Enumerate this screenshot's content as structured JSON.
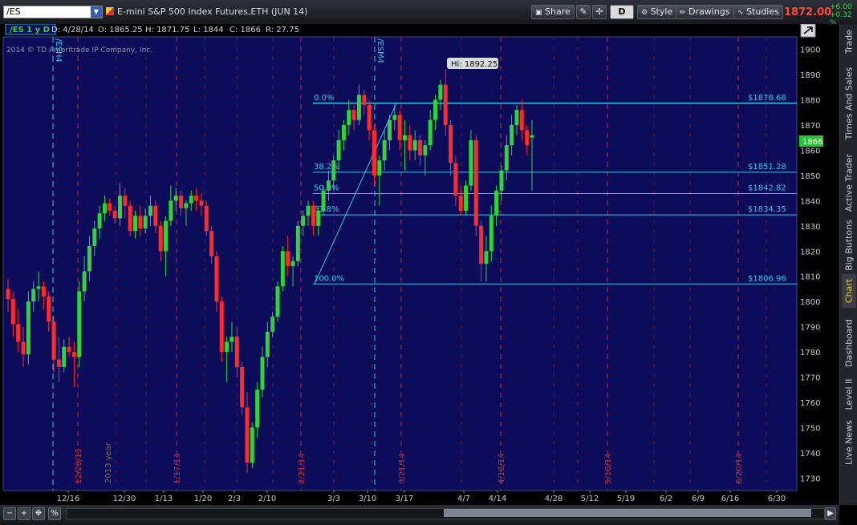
{
  "topbar": {
    "symbol": "/ES",
    "description": "E-mini S&P 500 Index Futures,ETH (JUN 14)",
    "buttons": {
      "share": "Share",
      "d": "D",
      "style": "Style",
      "drawings": "Drawings",
      "studies": "Studies"
    },
    "last_price": "1872.00",
    "change": "+6.00",
    "change_pct": "+0.32 %"
  },
  "chart_header": {
    "period": "/ES 1 y D",
    "date": "D: 4/28/14",
    "open": "O: 1865.25",
    "high": "H: 1871.75",
    "low": "L: 1844",
    "close": "C: 1866",
    "range": "R: 27.75",
    "copyright": "2014 © TD Ameritrade IP Company, Inc."
  },
  "side_tabs": [
    "Trade",
    "Times And Sales",
    "Active Trader",
    "Big Buttons",
    "Chart",
    "Dashboard",
    "Level II",
    "Live News"
  ],
  "side_active": "Chart",
  "chart_data": {
    "type": "candlestick",
    "ylim": [
      1725,
      1905
    ],
    "y_ticks": [
      1730,
      1740,
      1750,
      1760,
      1770,
      1780,
      1790,
      1800,
      1810,
      1820,
      1830,
      1840,
      1850,
      1860,
      1870,
      1880,
      1890,
      1900
    ],
    "x_ticks": [
      {
        "label": "12/16",
        "px": 85
      },
      {
        "label": "12/30",
        "px": 155
      },
      {
        "label": "1/13",
        "px": 204
      },
      {
        "label": "1/20",
        "px": 253
      },
      {
        "label": "2/3",
        "px": 292
      },
      {
        "label": "2/10",
        "px": 333
      },
      {
        "label": "3/3",
        "px": 416
      },
      {
        "label": "3/10",
        "px": 458
      },
      {
        "label": "3/17",
        "px": 504
      },
      {
        "label": "4/7",
        "px": 578
      },
      {
        "label": "4/14",
        "px": 620
      },
      {
        "label": "4/28",
        "px": 690
      },
      {
        "label": "5/12",
        "px": 735
      },
      {
        "label": "5/19",
        "px": 780
      },
      {
        "label": "6/2",
        "px": 830
      },
      {
        "label": "6/9",
        "px": 870
      },
      {
        "label": "6/16",
        "px": 910
      },
      {
        "label": "6/30",
        "px": 968
      }
    ],
    "period_lines": [
      "12/20/13",
      "1/17/14",
      "2/21/14",
      "3/21/14",
      "4/18/14",
      "5/16/14",
      "6/20/14"
    ],
    "year_label": "2013 year",
    "contract_lines": [
      "/ESH4",
      "/ESM4"
    ],
    "current_price_label": "1866",
    "high_label": "Hi: 1892.25",
    "fibonacci": [
      {
        "level": "0.0%",
        "price": "$1878.68",
        "value": 1878.68
      },
      {
        "level": "38.2%",
        "price": "$1851.28",
        "value": 1851.28
      },
      {
        "level": "50.0%",
        "price": "$1842.82",
        "value": 1842.82
      },
      {
        "level": "61.8%",
        "price": "$1834.35",
        "value": 1834.35
      },
      {
        "level": "100.0%",
        "price": "$1806.96",
        "value": 1806.96
      }
    ],
    "candles": [
      [
        1805,
        1809,
        1796,
        1801
      ],
      [
        1801,
        1804,
        1786,
        1791
      ],
      [
        1791,
        1797,
        1780,
        1784
      ],
      [
        1784,
        1790,
        1774,
        1779
      ],
      [
        1779,
        1804,
        1775,
        1800
      ],
      [
        1800,
        1808,
        1796,
        1805
      ],
      [
        1805,
        1812,
        1800,
        1806
      ],
      [
        1806,
        1808,
        1797,
        1802
      ],
      [
        1802,
        1804,
        1788,
        1792
      ],
      [
        1792,
        1794,
        1772,
        1777
      ],
      [
        1777,
        1786,
        1768,
        1774
      ],
      [
        1774,
        1785,
        1772,
        1782
      ],
      [
        1782,
        1786,
        1778,
        1780
      ],
      [
        1780,
        1784,
        1766,
        1778
      ],
      [
        1778,
        1808,
        1774,
        1804
      ],
      [
        1804,
        1818,
        1800,
        1812
      ],
      [
        1812,
        1826,
        1808,
        1822
      ],
      [
        1822,
        1832,
        1818,
        1829
      ],
      [
        1829,
        1838,
        1825,
        1835
      ],
      [
        1835,
        1842,
        1832,
        1839
      ],
      [
        1839,
        1841,
        1834,
        1836
      ],
      [
        1836,
        1838,
        1831,
        1833
      ],
      [
        1833,
        1847,
        1830,
        1842
      ],
      [
        1842,
        1845,
        1833,
        1838
      ],
      [
        1838,
        1840,
        1826,
        1828
      ],
      [
        1828,
        1836,
        1825,
        1834
      ],
      [
        1834,
        1838,
        1826,
        1829
      ],
      [
        1829,
        1837,
        1827,
        1834
      ],
      [
        1834,
        1842,
        1830,
        1838
      ],
      [
        1838,
        1840,
        1827,
        1830
      ],
      [
        1830,
        1832,
        1816,
        1820
      ],
      [
        1820,
        1834,
        1810,
        1832
      ],
      [
        1832,
        1846,
        1830,
        1840
      ],
      [
        1840,
        1845,
        1836,
        1842
      ],
      [
        1842,
        1844,
        1834,
        1837
      ],
      [
        1837,
        1840,
        1830,
        1839
      ],
      [
        1839,
        1844,
        1836,
        1842
      ],
      [
        1842,
        1845,
        1836,
        1840
      ],
      [
        1840,
        1843,
        1834,
        1838
      ],
      [
        1838,
        1840,
        1826,
        1828
      ],
      [
        1828,
        1830,
        1815,
        1818
      ],
      [
        1818,
        1820,
        1796,
        1800
      ],
      [
        1800,
        1802,
        1776,
        1780
      ],
      [
        1780,
        1786,
        1768,
        1784
      ],
      [
        1784,
        1792,
        1780,
        1786
      ],
      [
        1786,
        1790,
        1770,
        1774
      ],
      [
        1774,
        1776,
        1755,
        1758
      ],
      [
        1758,
        1764,
        1732,
        1736
      ],
      [
        1736,
        1752,
        1734,
        1750
      ],
      [
        1750,
        1768,
        1746,
        1765
      ],
      [
        1765,
        1782,
        1762,
        1778
      ],
      [
        1778,
        1792,
        1774,
        1788
      ],
      [
        1788,
        1796,
        1786,
        1794
      ],
      [
        1794,
        1808,
        1792,
        1806
      ],
      [
        1806,
        1822,
        1804,
        1820
      ],
      [
        1820,
        1826,
        1810,
        1814
      ],
      [
        1814,
        1818,
        1806,
        1816
      ],
      [
        1816,
        1832,
        1814,
        1830
      ],
      [
        1830,
        1836,
        1826,
        1834
      ],
      [
        1834,
        1840,
        1830,
        1838
      ],
      [
        1838,
        1840,
        1826,
        1830
      ],
      [
        1830,
        1838,
        1826,
        1836
      ],
      [
        1836,
        1846,
        1834,
        1844
      ],
      [
        1844,
        1852,
        1840,
        1848
      ],
      [
        1848,
        1858,
        1844,
        1856
      ],
      [
        1856,
        1868,
        1852,
        1864
      ],
      [
        1864,
        1872,
        1860,
        1870
      ],
      [
        1870,
        1880,
        1866,
        1876
      ],
      [
        1876,
        1878,
        1868,
        1872
      ],
      [
        1872,
        1886,
        1870,
        1882
      ],
      [
        1882,
        1884,
        1874,
        1878
      ],
      [
        1878,
        1880,
        1864,
        1868
      ],
      [
        1868,
        1870,
        1846,
        1850
      ],
      [
        1850,
        1858,
        1838,
        1856
      ],
      [
        1856,
        1868,
        1852,
        1864
      ],
      [
        1864,
        1874,
        1860,
        1872
      ],
      [
        1872,
        1878,
        1868,
        1874
      ],
      [
        1874,
        1876,
        1860,
        1864
      ],
      [
        1864,
        1872,
        1852,
        1866
      ],
      [
        1866,
        1870,
        1856,
        1860
      ],
      [
        1860,
        1868,
        1856,
        1864
      ],
      [
        1864,
        1866,
        1854,
        1858
      ],
      [
        1858,
        1864,
        1850,
        1862
      ],
      [
        1862,
        1876,
        1860,
        1872
      ],
      [
        1872,
        1882,
        1868,
        1880
      ],
      [
        1880,
        1888,
        1876,
        1886
      ],
      [
        1886,
        1892,
        1866,
        1870
      ],
      [
        1870,
        1872,
        1850,
        1855
      ],
      [
        1855,
        1858,
        1838,
        1842
      ],
      [
        1842,
        1846,
        1834,
        1836
      ],
      [
        1836,
        1848,
        1834,
        1846
      ],
      [
        1846,
        1868,
        1844,
        1864
      ],
      [
        1864,
        1866,
        1826,
        1830
      ],
      [
        1830,
        1832,
        1808,
        1815
      ],
      [
        1815,
        1826,
        1808,
        1820
      ],
      [
        1820,
        1838,
        1816,
        1834
      ],
      [
        1834,
        1846,
        1830,
        1844
      ],
      [
        1844,
        1854,
        1840,
        1852
      ],
      [
        1852,
        1866,
        1848,
        1862
      ],
      [
        1862,
        1874,
        1858,
        1870
      ],
      [
        1870,
        1878,
        1866,
        1876
      ],
      [
        1876,
        1880,
        1864,
        1868
      ],
      [
        1868,
        1870,
        1858,
        1862
      ],
      [
        1865,
        1872,
        1844,
        1866
      ]
    ]
  }
}
